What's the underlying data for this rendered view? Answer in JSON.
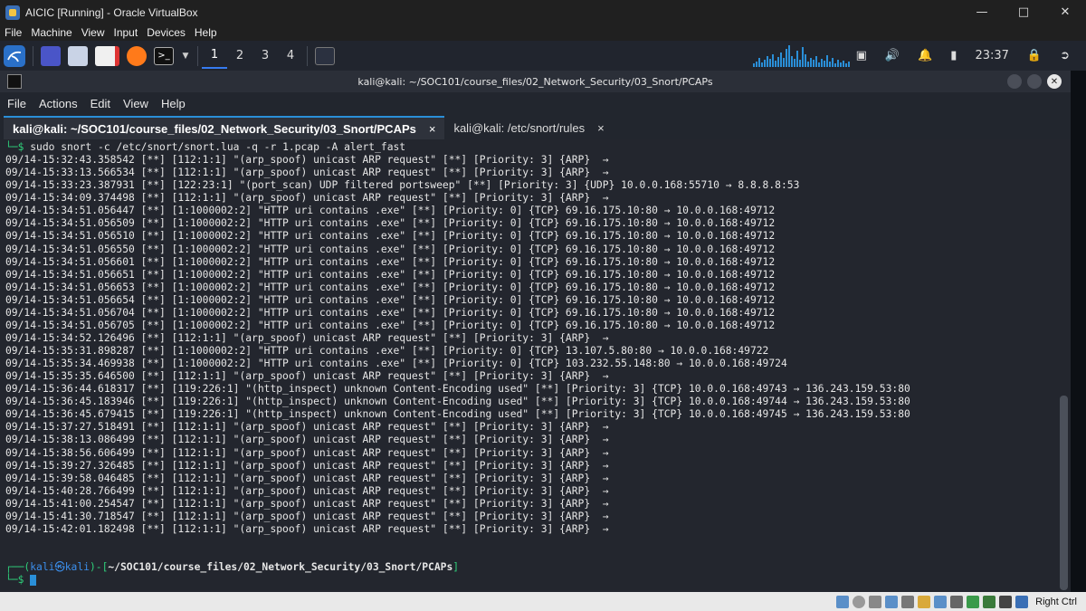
{
  "vbox": {
    "title": "AICIC [Running] - Oracle VirtualBox",
    "menu": [
      "File",
      "Machine",
      "View",
      "Input",
      "Devices",
      "Help"
    ],
    "host_key": "Right Ctrl"
  },
  "panel": {
    "workspaces": [
      "1",
      "2",
      "3",
      "4"
    ],
    "clock": "23:37"
  },
  "terminal": {
    "window_title": "kali@kali: ~/SOC101/course_files/02_Network_Security/03_Snort/PCAPs",
    "menu": [
      "File",
      "Actions",
      "Edit",
      "View",
      "Help"
    ],
    "tabs": [
      {
        "label": "kali@kali: ~/SOC101/course_files/02_Network_Security/03_Snort/PCAPs",
        "close": "×"
      },
      {
        "label": "kali@kali: /etc/snort/rules",
        "close": "×"
      }
    ],
    "command_prefix": "└─$ ",
    "command": "sudo snort -c /etc/snort/snort.lua -q -r 1.pcap -A alert_fast",
    "output_lines": [
      "09/14-15:32:43.358542 [**] [112:1:1] \"(arp_spoof) unicast ARP request\" [**] [Priority: 3] {ARP}  →",
      "09/14-15:33:13.566534 [**] [112:1:1] \"(arp_spoof) unicast ARP request\" [**] [Priority: 3] {ARP}  →",
      "09/14-15:33:23.387931 [**] [122:23:1] \"(port_scan) UDP filtered portsweep\" [**] [Priority: 3] {UDP} 10.0.0.168:55710 → 8.8.8.8:53",
      "09/14-15:34:09.374498 [**] [112:1:1] \"(arp_spoof) unicast ARP request\" [**] [Priority: 3] {ARP}  →",
      "09/14-15:34:51.056447 [**] [1:1000002:2] \"HTTP uri contains .exe\" [**] [Priority: 0] {TCP} 69.16.175.10:80 → 10.0.0.168:49712",
      "09/14-15:34:51.056509 [**] [1:1000002:2] \"HTTP uri contains .exe\" [**] [Priority: 0] {TCP} 69.16.175.10:80 → 10.0.0.168:49712",
      "09/14-15:34:51.056510 [**] [1:1000002:2] \"HTTP uri contains .exe\" [**] [Priority: 0] {TCP} 69.16.175.10:80 → 10.0.0.168:49712",
      "09/14-15:34:51.056550 [**] [1:1000002:2] \"HTTP uri contains .exe\" [**] [Priority: 0] {TCP} 69.16.175.10:80 → 10.0.0.168:49712",
      "09/14-15:34:51.056601 [**] [1:1000002:2] \"HTTP uri contains .exe\" [**] [Priority: 0] {TCP} 69.16.175.10:80 → 10.0.0.168:49712",
      "09/14-15:34:51.056651 [**] [1:1000002:2] \"HTTP uri contains .exe\" [**] [Priority: 0] {TCP} 69.16.175.10:80 → 10.0.0.168:49712",
      "09/14-15:34:51.056653 [**] [1:1000002:2] \"HTTP uri contains .exe\" [**] [Priority: 0] {TCP} 69.16.175.10:80 → 10.0.0.168:49712",
      "09/14-15:34:51.056654 [**] [1:1000002:2] \"HTTP uri contains .exe\" [**] [Priority: 0] {TCP} 69.16.175.10:80 → 10.0.0.168:49712",
      "09/14-15:34:51.056704 [**] [1:1000002:2] \"HTTP uri contains .exe\" [**] [Priority: 0] {TCP} 69.16.175.10:80 → 10.0.0.168:49712",
      "09/14-15:34:51.056705 [**] [1:1000002:2] \"HTTP uri contains .exe\" [**] [Priority: 0] {TCP} 69.16.175.10:80 → 10.0.0.168:49712",
      "09/14-15:34:52.126496 [**] [112:1:1] \"(arp_spoof) unicast ARP request\" [**] [Priority: 3] {ARP}  →",
      "09/14-15:35:31.898287 [**] [1:1000002:2] \"HTTP uri contains .exe\" [**] [Priority: 0] {TCP} 13.107.5.80:80 → 10.0.0.168:49722",
      "09/14-15:35:34.469938 [**] [1:1000002:2] \"HTTP uri contains .exe\" [**] [Priority: 0] {TCP} 103.232.55.148:80 → 10.0.0.168:49724",
      "09/14-15:35:35.646500 [**] [112:1:1] \"(arp_spoof) unicast ARP request\" [**] [Priority: 3] {ARP}  →",
      "09/14-15:36:44.618317 [**] [119:226:1] \"(http_inspect) unknown Content-Encoding used\" [**] [Priority: 3] {TCP} 10.0.0.168:49743 → 136.243.159.53:80",
      "09/14-15:36:45.183946 [**] [119:226:1] \"(http_inspect) unknown Content-Encoding used\" [**] [Priority: 3] {TCP} 10.0.0.168:49744 → 136.243.159.53:80",
      "09/14-15:36:45.679415 [**] [119:226:1] \"(http_inspect) unknown Content-Encoding used\" [**] [Priority: 3] {TCP} 10.0.0.168:49745 → 136.243.159.53:80",
      "09/14-15:37:27.518491 [**] [112:1:1] \"(arp_spoof) unicast ARP request\" [**] [Priority: 3] {ARP}  →",
      "09/14-15:38:13.086499 [**] [112:1:1] \"(arp_spoof) unicast ARP request\" [**] [Priority: 3] {ARP}  →",
      "09/14-15:38:56.606499 [**] [112:1:1] \"(arp_spoof) unicast ARP request\" [**] [Priority: 3] {ARP}  →",
      "09/14-15:39:27.326485 [**] [112:1:1] \"(arp_spoof) unicast ARP request\" [**] [Priority: 3] {ARP}  →",
      "09/14-15:39:58.046485 [**] [112:1:1] \"(arp_spoof) unicast ARP request\" [**] [Priority: 3] {ARP}  →",
      "09/14-15:40:28.766499 [**] [112:1:1] \"(arp_spoof) unicast ARP request\" [**] [Priority: 3] {ARP}  →",
      "09/14-15:41:00.254547 [**] [112:1:1] \"(arp_spoof) unicast ARP request\" [**] [Priority: 3] {ARP}  →",
      "09/14-15:41:30.718547 [**] [112:1:1] \"(arp_spoof) unicast ARP request\" [**] [Priority: 3] {ARP}  →",
      "09/14-15:42:01.182498 [**] [112:1:1] \"(arp_spoof) unicast ARP request\" [**] [Priority: 3] {ARP}  →"
    ],
    "prompt": {
      "line1_prefix": "┌──(",
      "user": "kali",
      "at": "㉿",
      "host": "kali",
      "mid": ")-[",
      "path": "~/SOC101/course_files/02_Network_Security/03_Snort/PCAPs",
      "end": "]",
      "line2": "└─$ "
    }
  },
  "colors": {
    "prompt_green": "#2fd17b",
    "prompt_blue": "#3b8eea",
    "accent": "#2a8fd8"
  }
}
